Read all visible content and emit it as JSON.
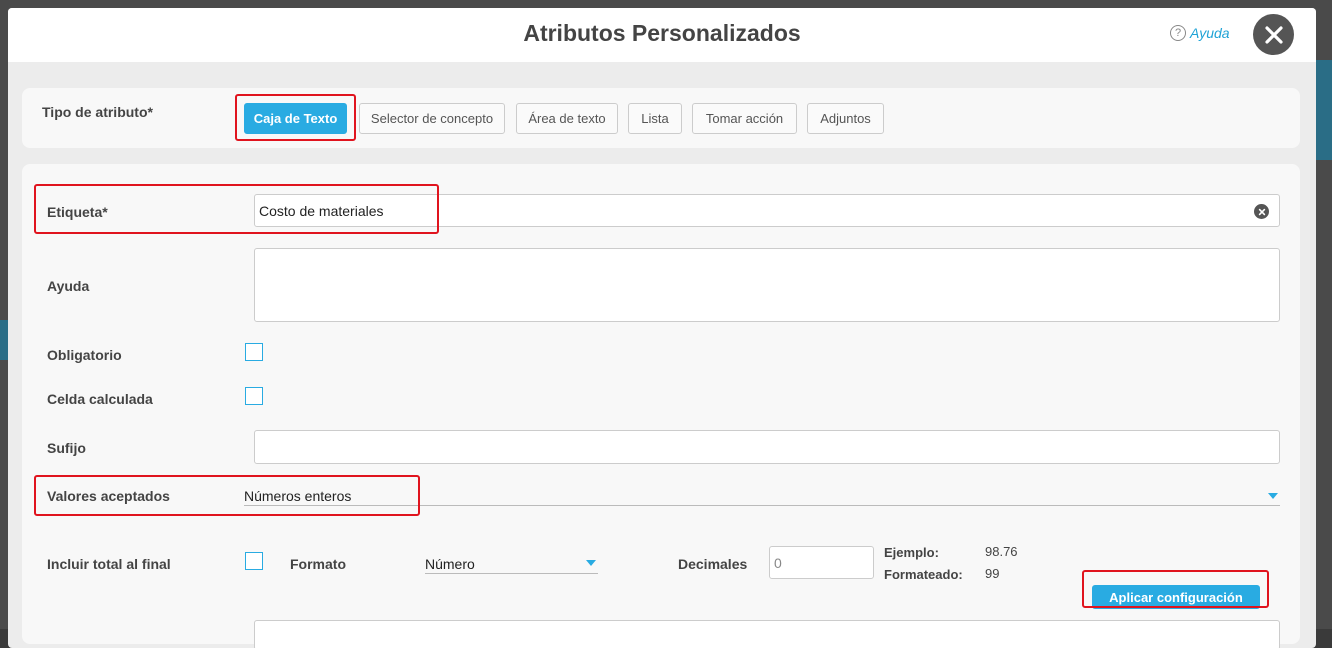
{
  "header": {
    "title": "Atributos Personalizados",
    "help_label": "Ayuda",
    "help_icon": "?"
  },
  "attribute_type": {
    "label": "Tipo de atributo*",
    "options": [
      "Caja de Texto",
      "Selector de concepto",
      "Área de texto",
      "Lista",
      "Tomar acción",
      "Adjuntos"
    ],
    "selected": "Caja de Texto"
  },
  "form": {
    "label_field": {
      "label": "Etiqueta*",
      "value": "Costo de materiales"
    },
    "help_field": {
      "label": "Ayuda",
      "value": ""
    },
    "required": {
      "label": "Obligatorio"
    },
    "calculated": {
      "label": "Celda calculada"
    },
    "suffix": {
      "label": "Sufijo",
      "value": ""
    },
    "accepted_values": {
      "label": "Valores aceptados",
      "value": "Números enteros"
    },
    "include_total": {
      "label": "Incluir total al final"
    },
    "format": {
      "label": "Formato",
      "value": "Número"
    },
    "decimals": {
      "label": "Decimales",
      "placeholder": "0"
    },
    "example": {
      "label": "Ejemplo:",
      "value": "98.76"
    },
    "formatted": {
      "label": "Formateado:",
      "value": "99"
    },
    "apply_label": "Aplicar configuración"
  },
  "colors": {
    "accent": "#29abe2",
    "highlight": "#e0141e"
  }
}
